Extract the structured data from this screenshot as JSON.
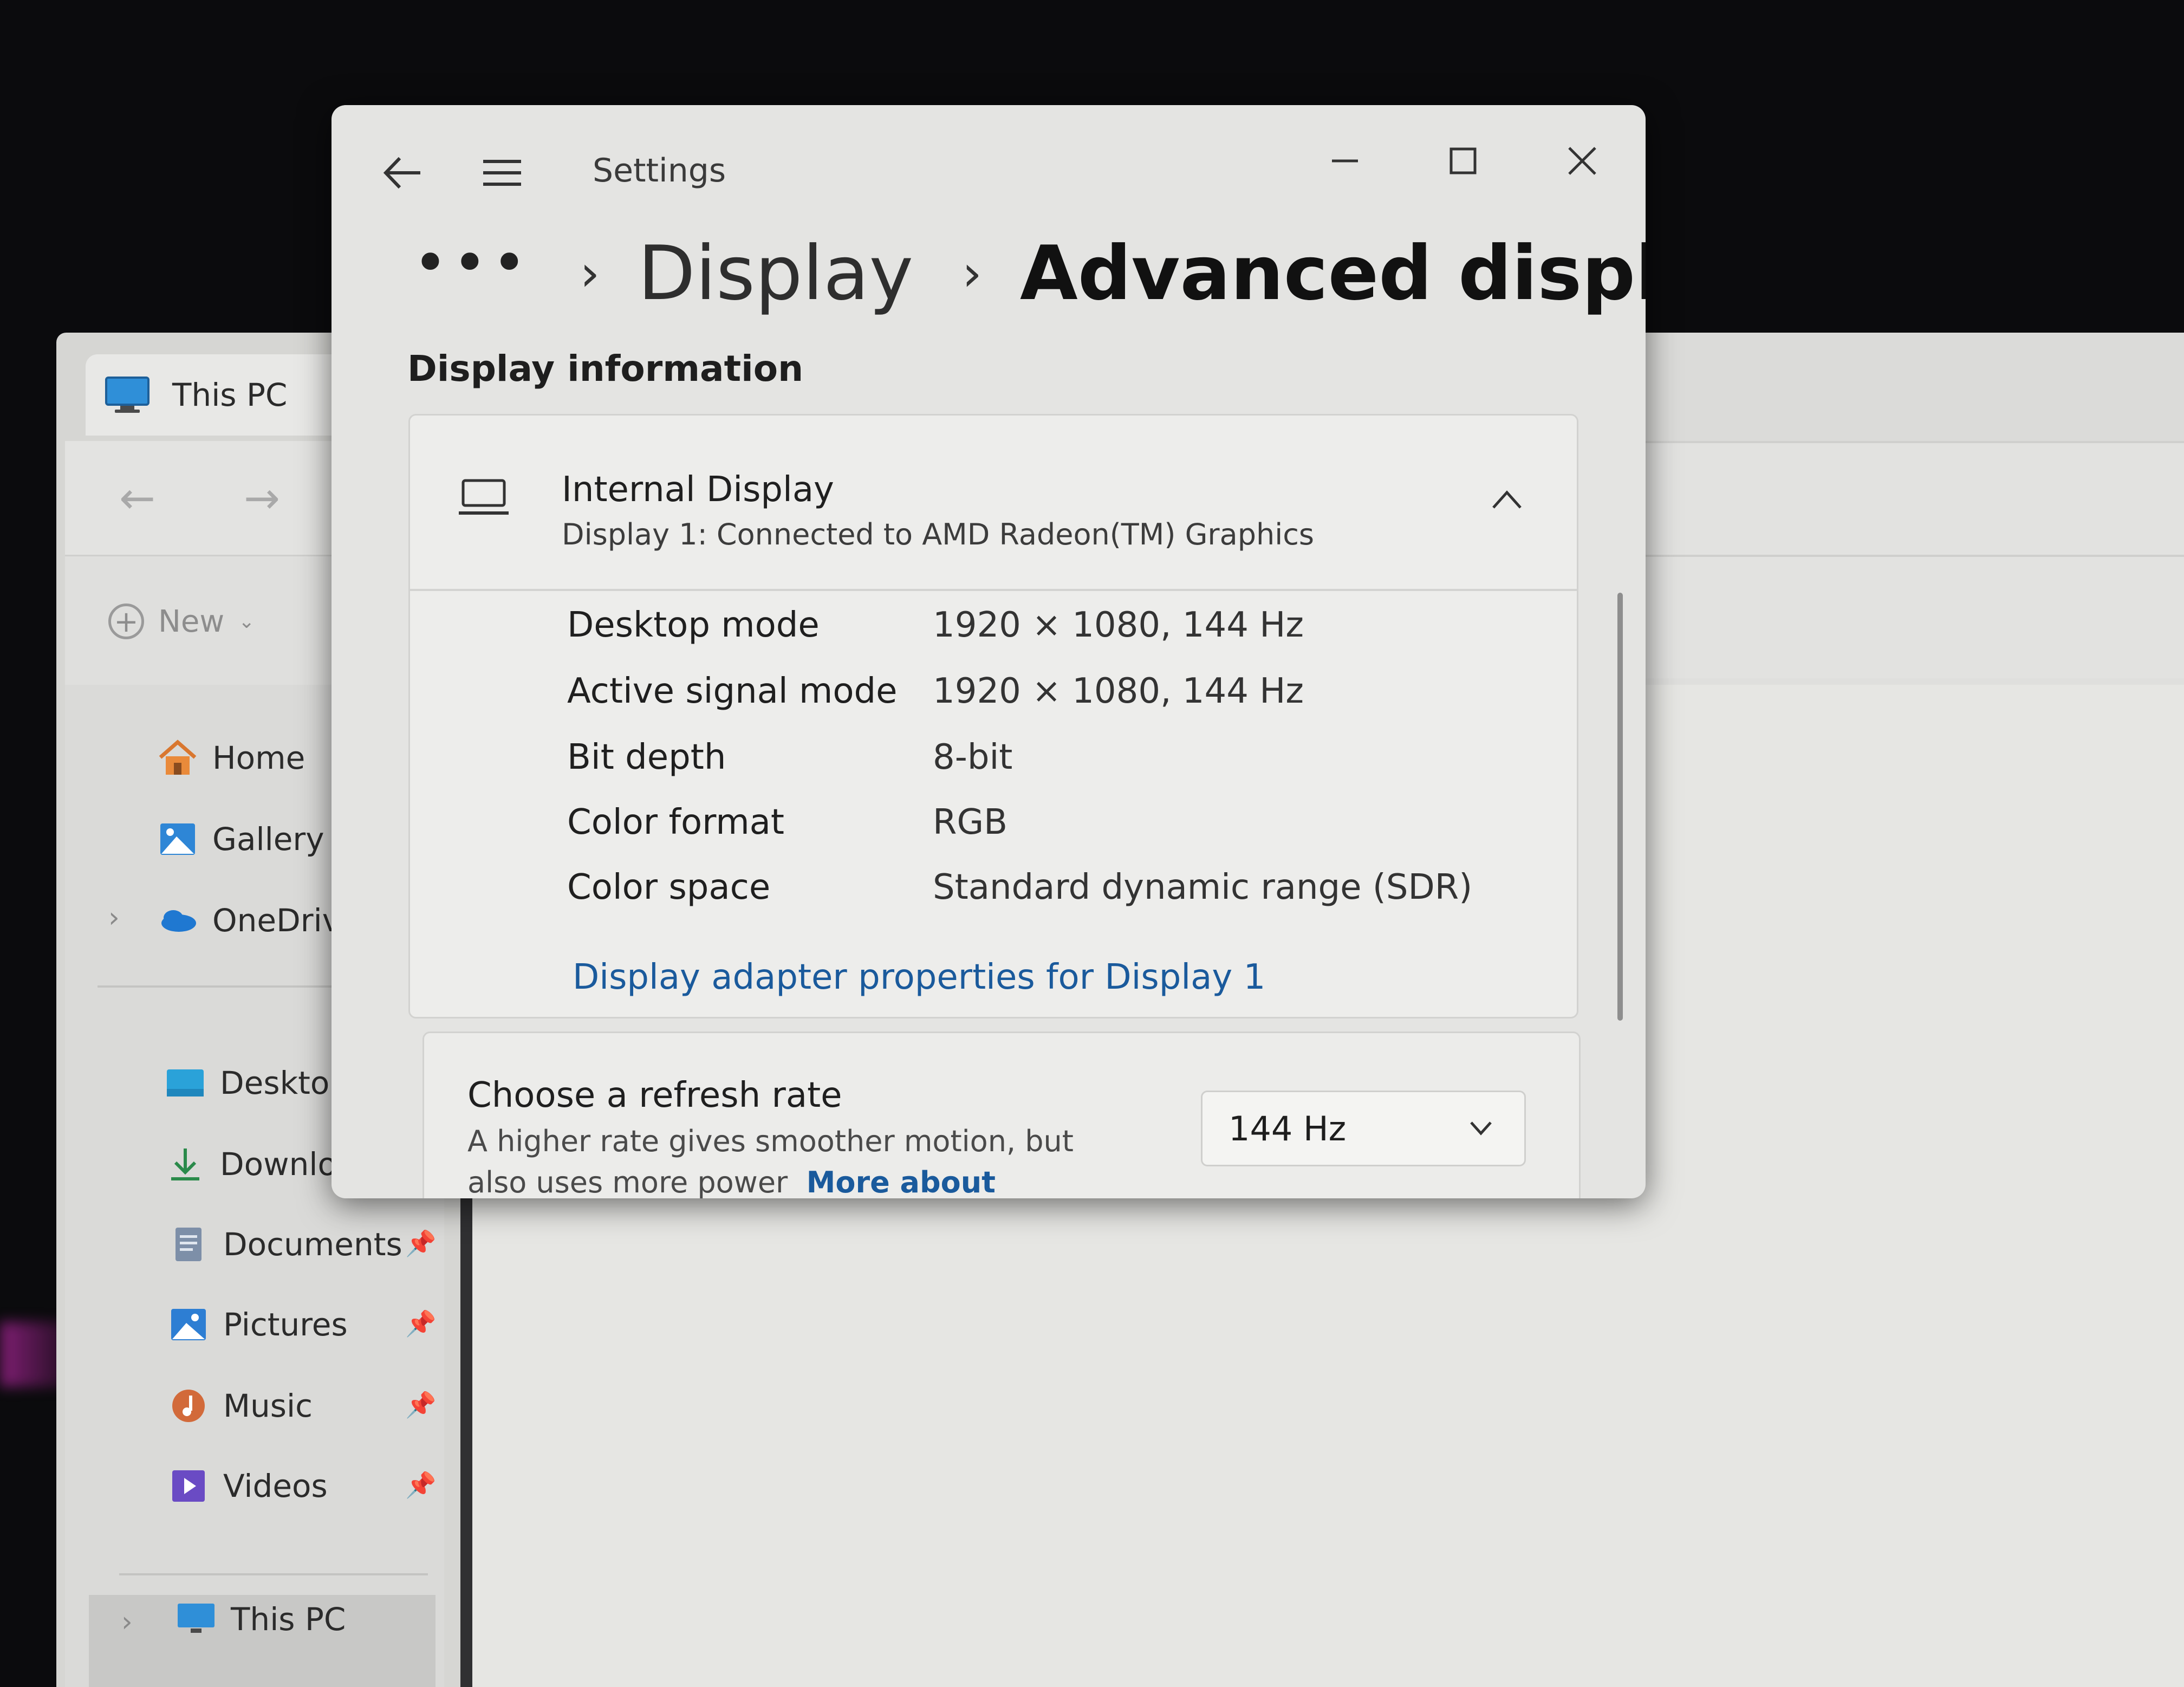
{
  "explorer": {
    "tab_title": "This PC",
    "toolbar": {
      "new_label": "New"
    },
    "nav_arrows": {
      "back": "←",
      "forward": "→"
    },
    "sidebar": {
      "items": [
        {
          "label": "Home",
          "icon": "home-icon"
        },
        {
          "label": "Gallery",
          "icon": "gallery-icon"
        },
        {
          "label": "OneDrive",
          "icon": "onedrive-icon"
        },
        {
          "label": "Desktop",
          "icon": "desktop-folder-icon"
        },
        {
          "label": "Downloac",
          "icon": "download-icon"
        },
        {
          "label": "Documents",
          "icon": "documents-icon"
        },
        {
          "label": "Pictures",
          "icon": "pictures-icon"
        },
        {
          "label": "Music",
          "icon": "music-icon"
        },
        {
          "label": "Videos",
          "icon": "videos-icon"
        },
        {
          "label": "This PC",
          "icon": "monitor-icon"
        }
      ]
    }
  },
  "settings": {
    "window_title": "Settings",
    "breadcrumb": {
      "more": "•••",
      "parent": "Display",
      "current": "Advanced display"
    },
    "section_label": "Display information",
    "display_card": {
      "title": "Internal Display",
      "subtitle": "Display 1: Connected to AMD Radeon(TM) Graphics",
      "rows": [
        {
          "label": "Desktop mode",
          "value": "1920 × 1080, 144 Hz"
        },
        {
          "label": "Active signal mode",
          "value": "1920 × 1080, 144 Hz"
        },
        {
          "label": "Bit depth",
          "value": "8-bit"
        },
        {
          "label": "Color format",
          "value": "RGB"
        },
        {
          "label": "Color space",
          "value": "Standard dynamic range (SDR)"
        }
      ],
      "adapter_link": "Display adapter properties for Display 1"
    },
    "refresh_card": {
      "title": "Choose a refresh rate",
      "description": "A higher rate gives smoother motion, but also uses more power",
      "link": "More about refresh rate",
      "selected_rate": "144 Hz"
    }
  },
  "colors": {
    "accent_link": "#1a5a9c",
    "window_bg": "#e4e4e2",
    "card_bg": "#ededeb"
  }
}
